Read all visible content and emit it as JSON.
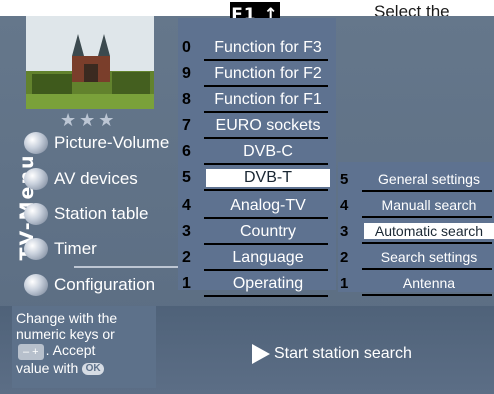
{
  "header": {
    "prompt": "Select the",
    "f1_label": "F1"
  },
  "stars": "★★★",
  "side_title": "TV-Menu",
  "left_menu": [
    {
      "label": "Picture-Volume"
    },
    {
      "label": "AV devices"
    },
    {
      "label": "Station table"
    },
    {
      "label": "Timer"
    },
    {
      "label": "Configuration",
      "selected": true
    }
  ],
  "middle_menu": [
    {
      "num": "0",
      "label": "Function for F3"
    },
    {
      "num": "9",
      "label": "Function for F2"
    },
    {
      "num": "8",
      "label": "Function for F1"
    },
    {
      "num": "7",
      "label": "EURO sockets"
    },
    {
      "num": "6",
      "label": "DVB-C"
    },
    {
      "num": "5",
      "label": "DVB-T",
      "selected": true
    },
    {
      "num": "4",
      "label": "Analog-TV"
    },
    {
      "num": "3",
      "label": "Country"
    },
    {
      "num": "2",
      "label": "Language"
    },
    {
      "num": "1",
      "label": "Operating"
    }
  ],
  "right_menu": [
    {
      "num": "5",
      "label": "General settings"
    },
    {
      "num": "4",
      "label": "Manuall search"
    },
    {
      "num": "3",
      "label": "Automatic search",
      "selected": true
    },
    {
      "num": "2",
      "label": "Search settings"
    },
    {
      "num": "1",
      "label": "Antenna"
    }
  ],
  "help": {
    "line1": "Change with the",
    "line2": "numeric keys or",
    "keys": "– +",
    "line3": ". Accept",
    "line4": "value with",
    "ok": "OK"
  },
  "action": {
    "label": "Start station search"
  },
  "colors": {
    "panel": "#5e7290",
    "background": "#65778b",
    "selected": "#ffffff"
  }
}
